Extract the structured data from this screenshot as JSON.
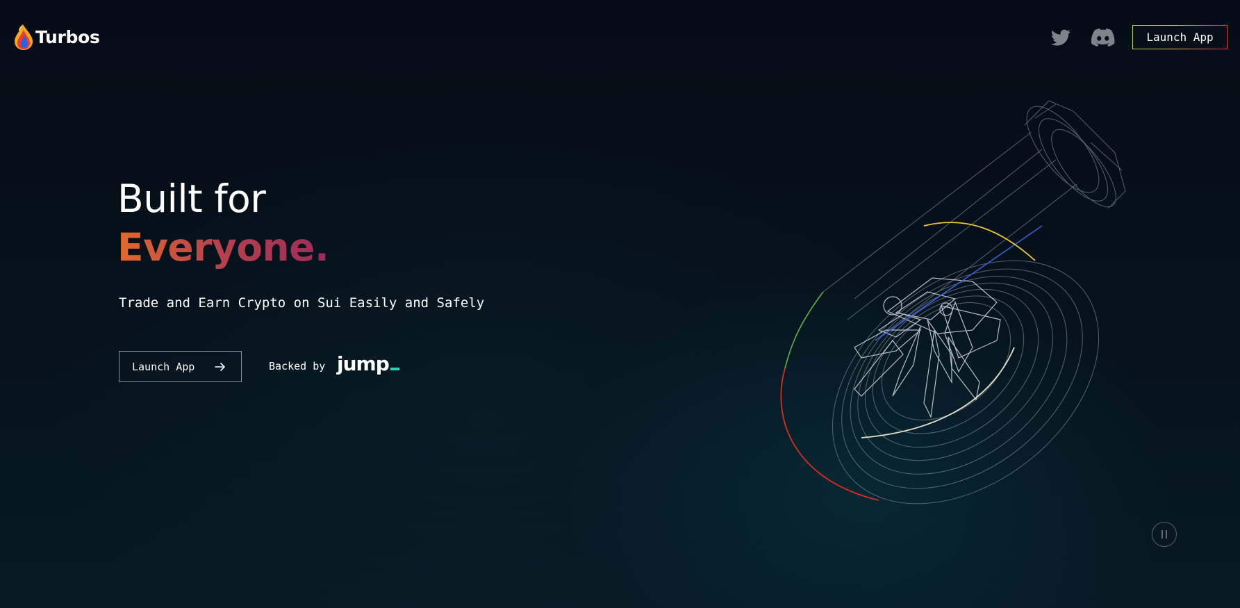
{
  "header": {
    "brand_name": "Turbos",
    "launch_label": "Launch App",
    "social": [
      "twitter-icon",
      "discord-icon"
    ]
  },
  "hero": {
    "title_line1": "Built for",
    "title_line2": "Everyone.",
    "subtitle": "Trade and Earn Crypto on Sui Easily and Safely",
    "cta_label": "Launch App",
    "backed_by_label": "Backed by",
    "backer_logo_text": "jump"
  },
  "colors": {
    "background": "#06101a",
    "gradient_orange": "#e2692c",
    "gradient_magenta": "#9c2a5a",
    "jump_accent": "#27d3b3",
    "header_border_start": "#b9d94e",
    "header_border_end": "#d9344c"
  },
  "controls": {
    "media_toggle": "pause-icon"
  }
}
